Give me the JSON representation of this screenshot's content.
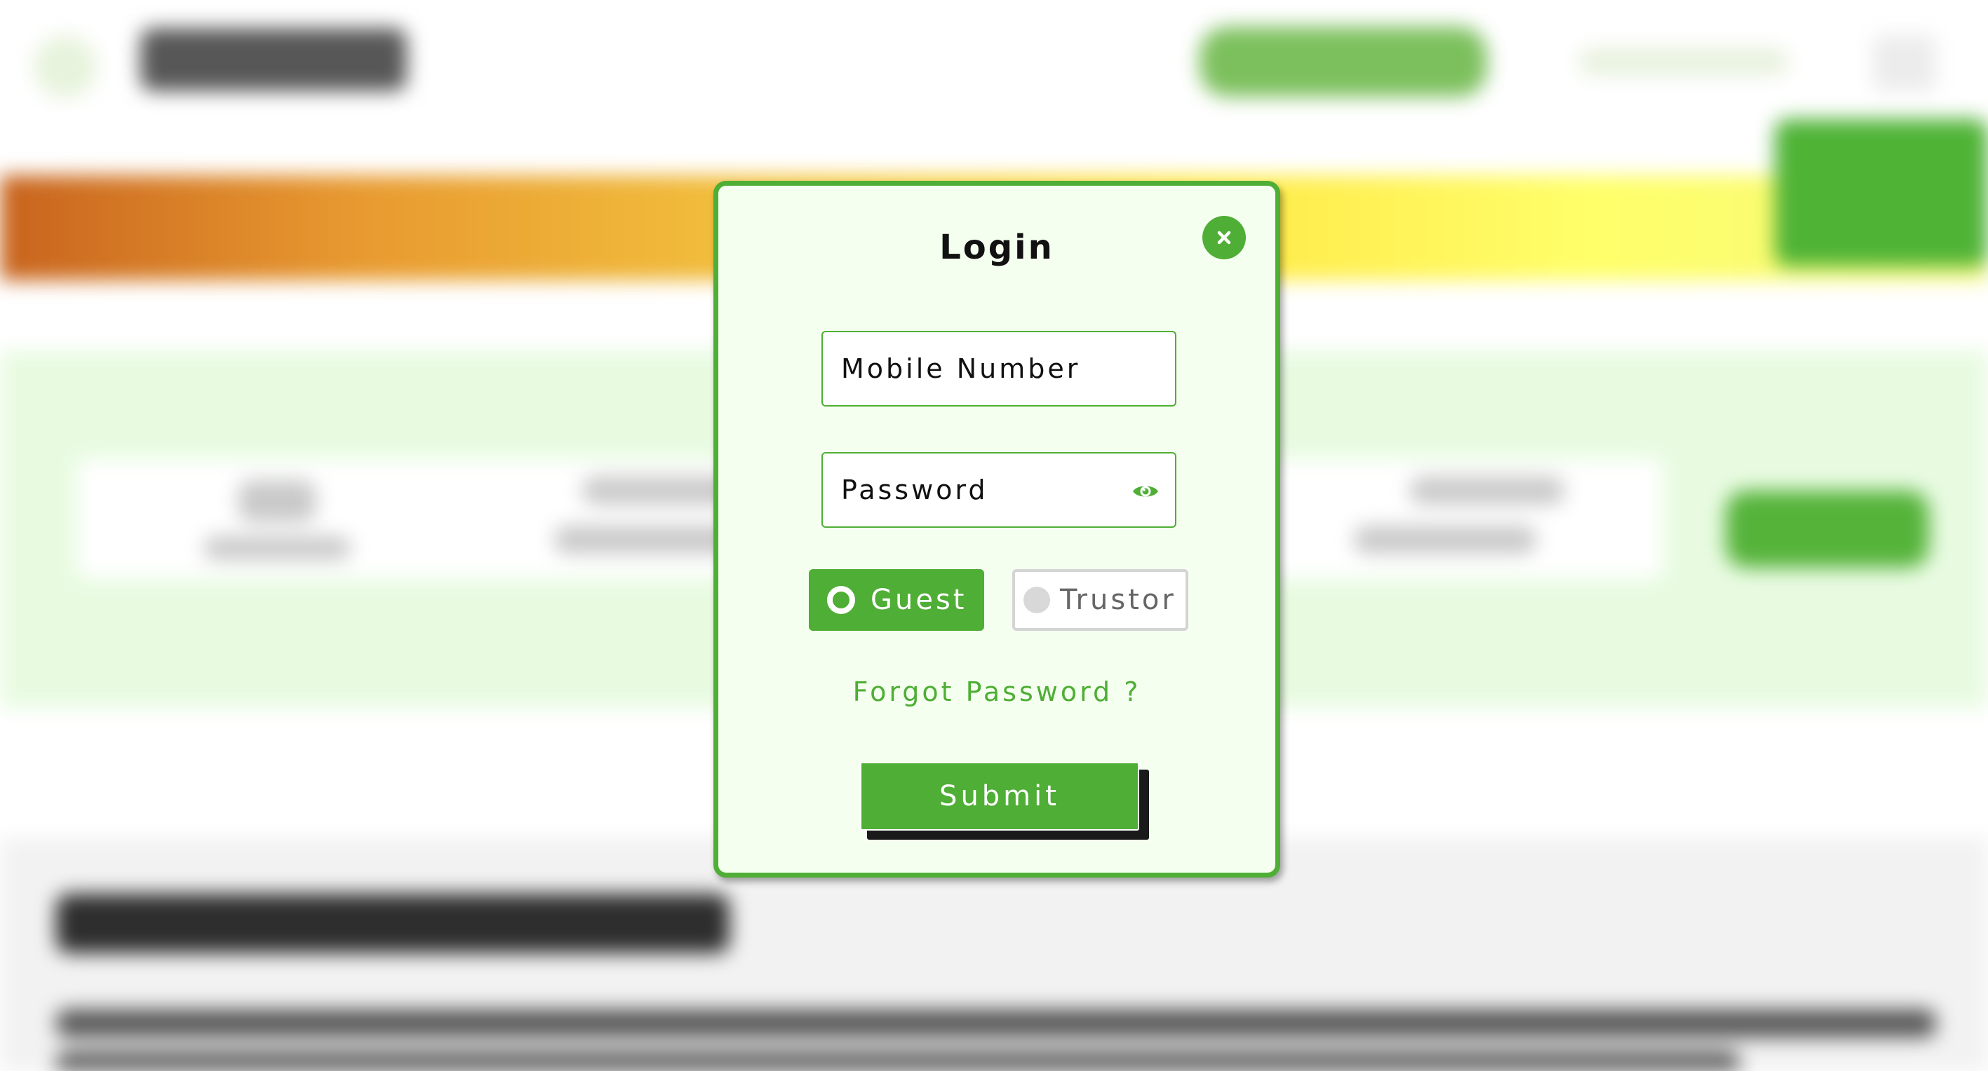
{
  "login_modal": {
    "title": "Login",
    "mobile_placeholder": "Mobile Number",
    "password_placeholder": "Password",
    "roles": [
      {
        "label": "Guest",
        "selected": true
      },
      {
        "label": "Trustor",
        "selected": false
      }
    ],
    "forgot_password_label": "Forgot Password ?",
    "submit_label": "Submit",
    "icons": {
      "close": "close-icon",
      "password_visibility": "eye-icon"
    }
  },
  "colors": {
    "accent": "#4fae35",
    "modal_background": "#f5fff0",
    "text": "#111111"
  }
}
